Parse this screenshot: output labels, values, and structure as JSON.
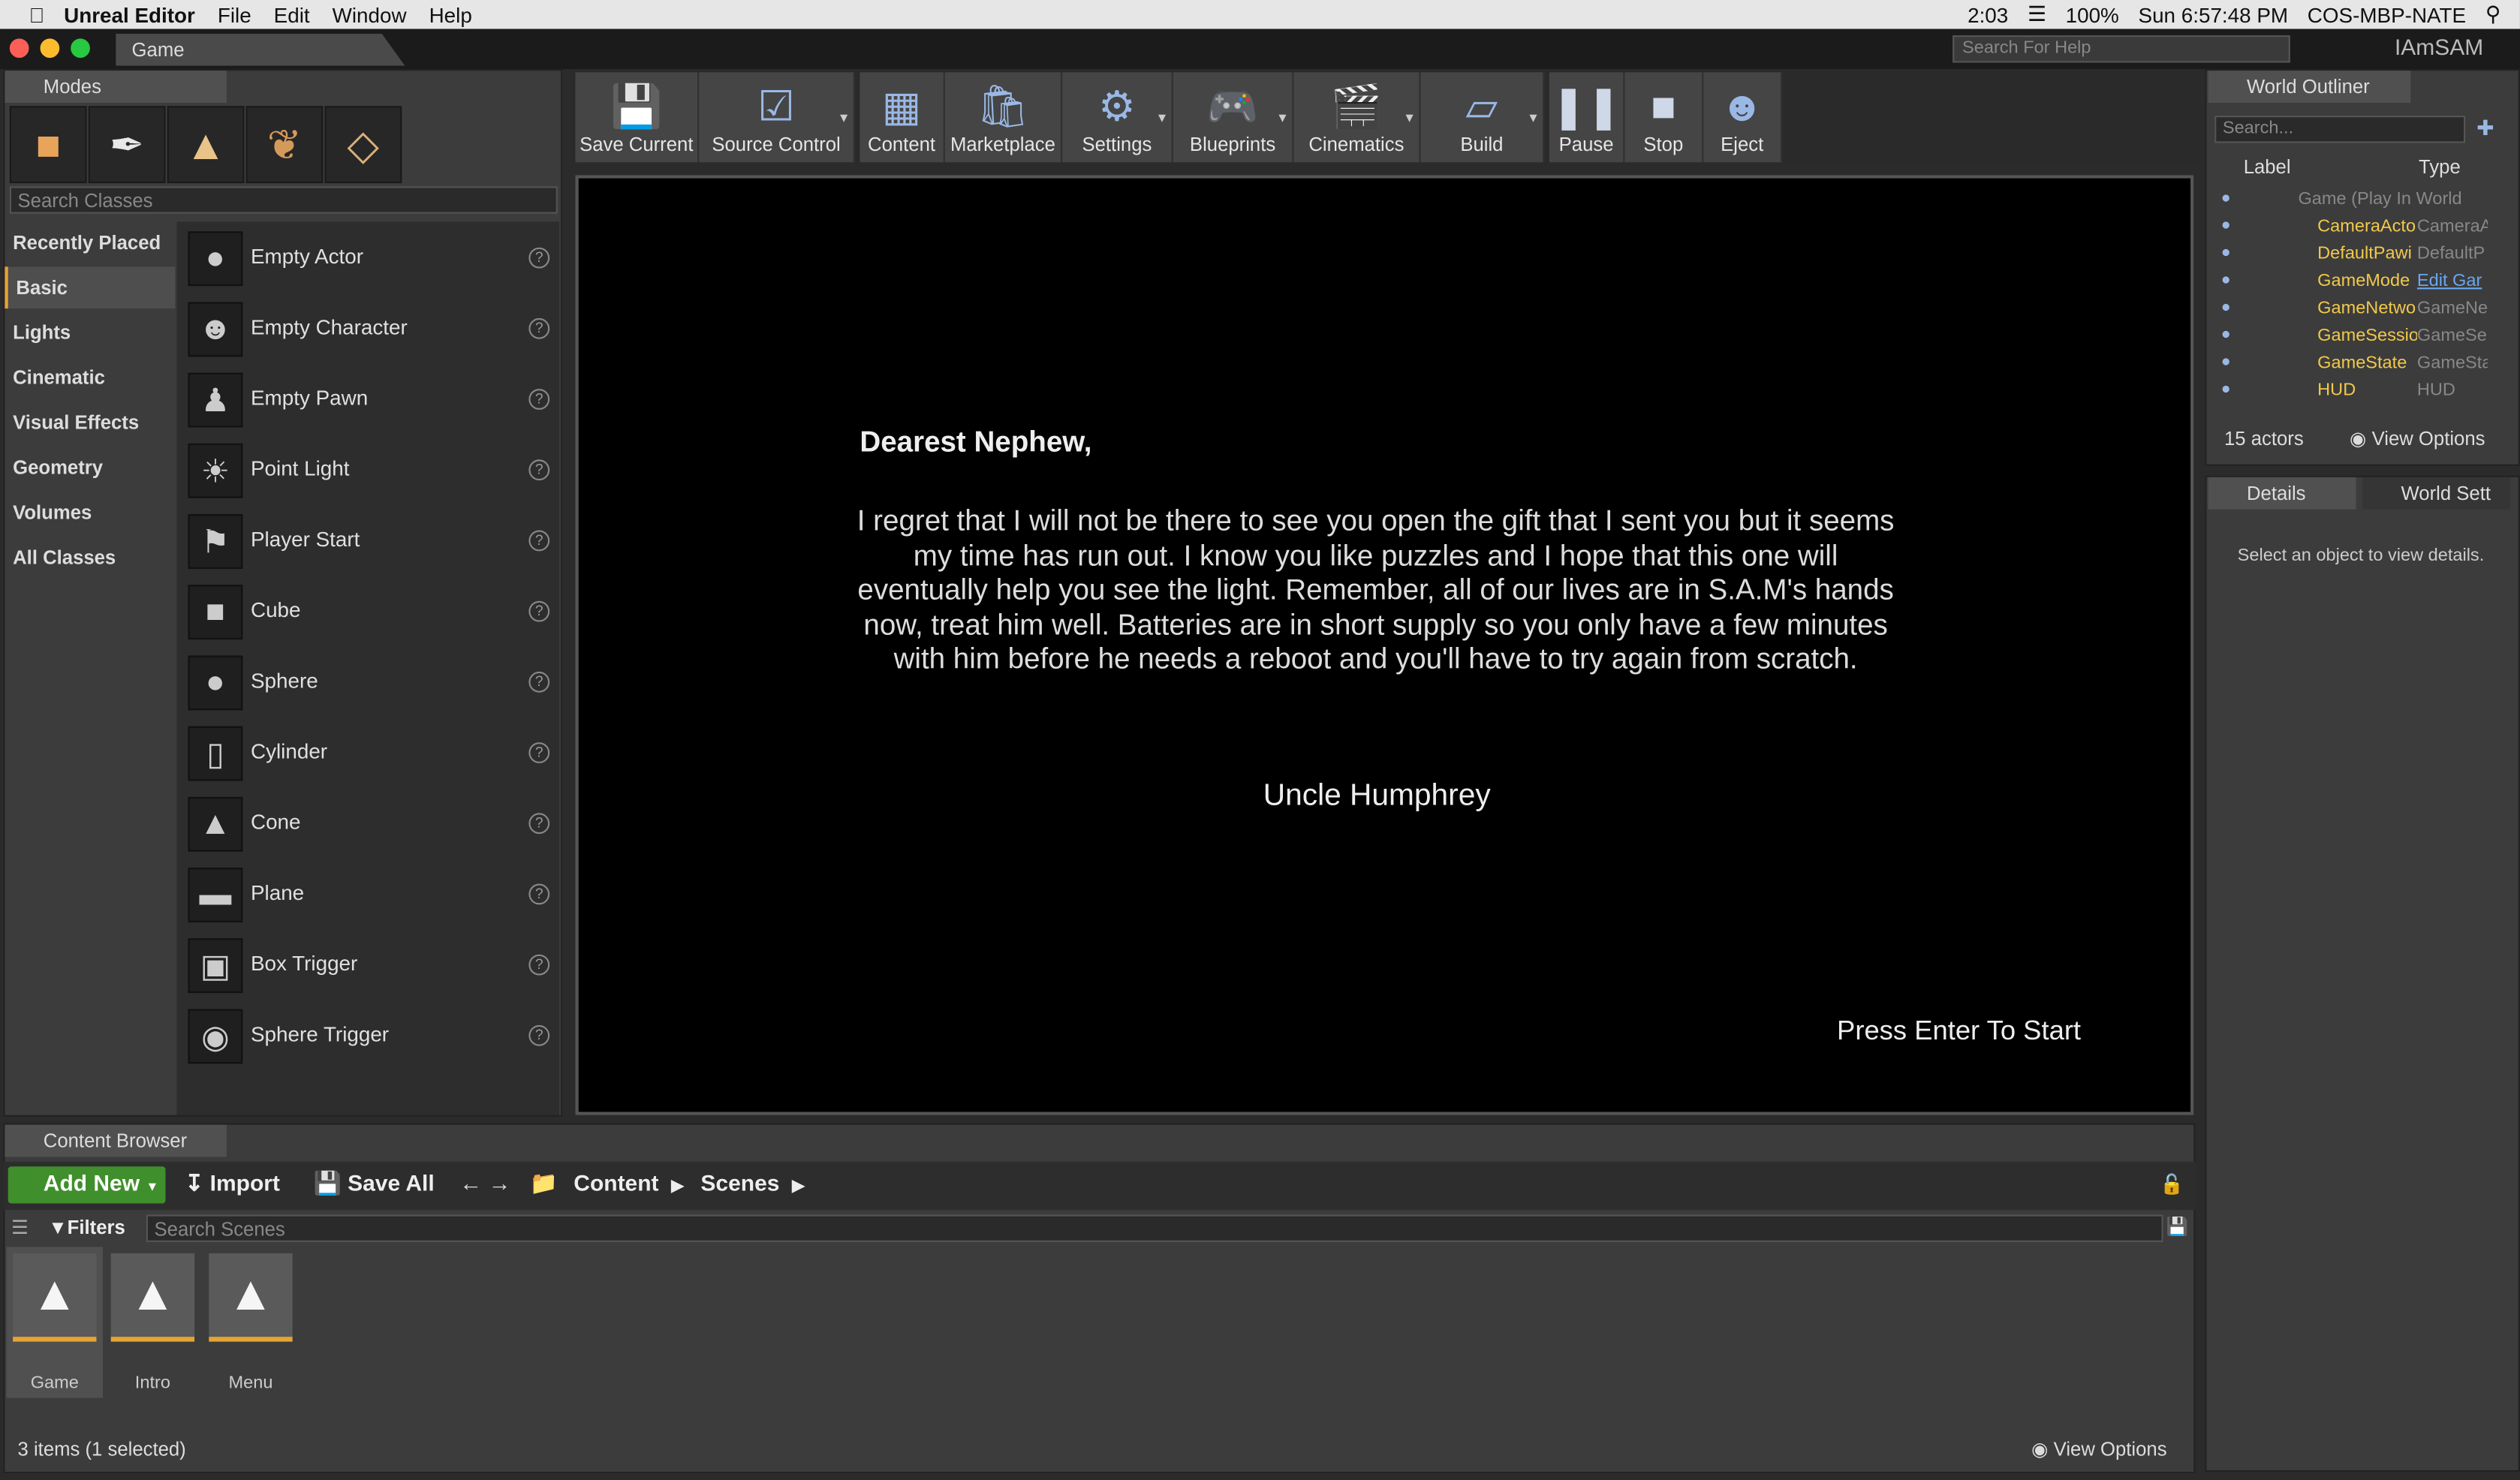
{
  "menubar": {
    "app": "Unreal Editor",
    "items": [
      "File",
      "Edit",
      "Window",
      "Help"
    ],
    "status": {
      "timer": "2:03",
      "battery": "100%",
      "datetime": "Sun 6:57:48 PM",
      "host": "COS-MBP-NATE"
    }
  },
  "window": {
    "doc_tab": "Game",
    "help_search_placeholder": "Search For Help",
    "user": "IAmSAM"
  },
  "modes": {
    "tab": "Modes",
    "search_placeholder": "Search Classes",
    "categories": [
      "Recently Placed",
      "Basic",
      "Lights",
      "Cinematic",
      "Visual Effects",
      "Geometry",
      "Volumes",
      "All Classes"
    ],
    "selected_category": "Basic",
    "classes": [
      "Empty Actor",
      "Empty Character",
      "Empty Pawn",
      "Point Light",
      "Player Start",
      "Cube",
      "Sphere",
      "Cylinder",
      "Cone",
      "Plane",
      "Box Trigger",
      "Sphere Trigger"
    ]
  },
  "toolbar": {
    "buttons": [
      "Save Current",
      "Source Control",
      "Content",
      "Marketplace",
      "Settings",
      "Blueprints",
      "Cinematics",
      "Build",
      "Pause",
      "Stop",
      "Eject"
    ]
  },
  "viewport": {
    "greeting": "Dearest Nephew,",
    "body": "I regret that I will not be there to see you open the gift that I sent you but it seems my time has run out. I know you like puzzles and I hope that this one will eventually help you see the light. Remember, all of our lives are in S.A.M's hands now, treat him well. Batteries are in short supply so you only have a few minutes with him before he needs a reboot and you'll have to try again from scratch.",
    "signature": "Uncle Humphrey",
    "prompt": "Press Enter To Start"
  },
  "outliner": {
    "tab": "World Outliner",
    "search_placeholder": "Search...",
    "col_label": "Label",
    "col_type": "Type",
    "root": "Game (Play In World",
    "rows": [
      {
        "name": "CameraActo",
        "type": "CameraA"
      },
      {
        "name": "DefaultPawi",
        "type": "DefaultP"
      },
      {
        "name": "GameMode",
        "type": "Edit Gar"
      },
      {
        "name": "GameNetwo",
        "type": "GameNe"
      },
      {
        "name": "GameSessio",
        "type": "GameSe"
      },
      {
        "name": "GameState",
        "type": "GameSta"
      },
      {
        "name": "HUD",
        "type": "HUD"
      }
    ],
    "count": "15 actors",
    "view_options": "View Options"
  },
  "details": {
    "tab": "Details",
    "tab2": "World Sett",
    "empty_message": "Select an object to view details."
  },
  "content_browser": {
    "tab": "Content Browser",
    "add_new": "Add New",
    "import": "Import",
    "save_all": "Save All",
    "path": [
      "Content",
      "Scenes"
    ],
    "filters": "Filters",
    "search_placeholder": "Search Scenes",
    "assets": [
      "Game",
      "Intro",
      "Menu"
    ],
    "status": "3 items (1 selected)",
    "view_options": "View Options"
  }
}
